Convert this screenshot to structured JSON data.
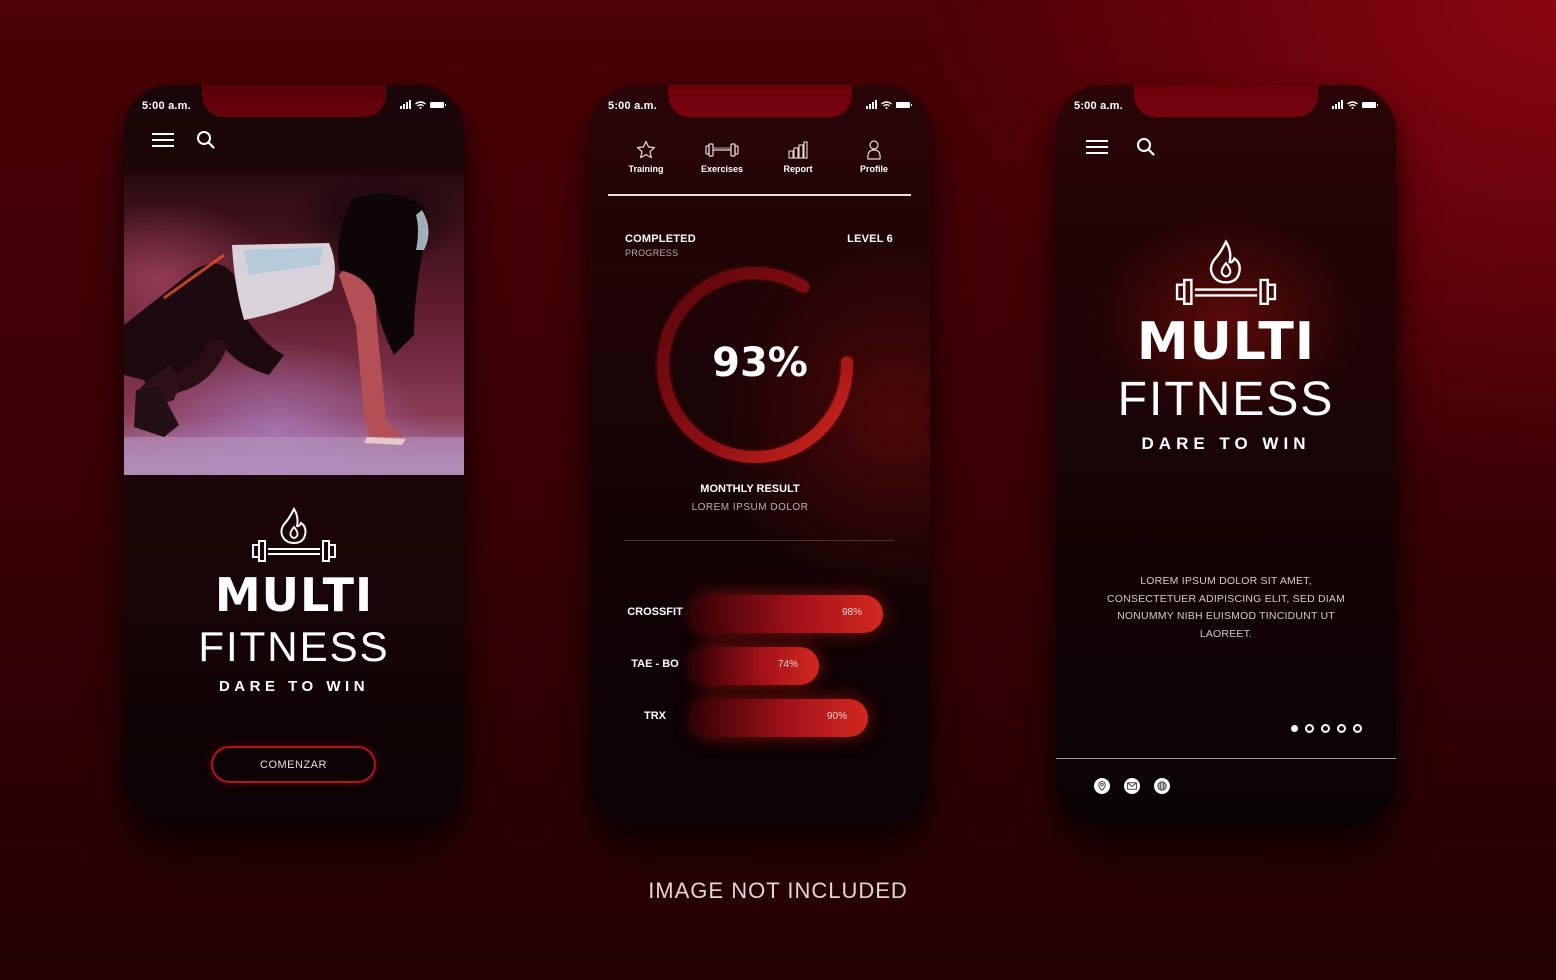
{
  "status_bar": {
    "time": "5:00 a.m."
  },
  "brand": {
    "name_primary": "MULTI",
    "name_secondary": "FITNESS",
    "tagline": "DARE TO WIN",
    "icon": "flame-barbell-icon"
  },
  "colors": {
    "accent": "#c81e1e",
    "accent_dark": "#7a0008",
    "background": "#3a0005",
    "phone_bg": "#120406",
    "text": "#ffffff",
    "text_muted": "#bdb0b0"
  },
  "screen_welcome": {
    "menu_icon": "hamburger-menu-icon",
    "search_icon": "search-icon",
    "hero_image_alt": "Woman in sprint start position with pink smoke",
    "cta_label": "COMENZAR"
  },
  "screen_progress": {
    "tabs": [
      {
        "label": "Training",
        "icon": "star-icon"
      },
      {
        "label": "Exercises",
        "icon": "dumbbell-icon"
      },
      {
        "label": "Report",
        "icon": "bar-chart-icon"
      },
      {
        "label": "Profile",
        "icon": "user-icon"
      }
    ],
    "completed_title": "COMPLETED",
    "completed_sub": "PROGRESS",
    "level_label": "LEVEL 6",
    "ring_percent": 93,
    "ring_label": "93%",
    "monthly_title": "MONTHLY RESULT",
    "monthly_sub": "LOREM IPSUM DOLOR",
    "bars": [
      {
        "label": "CROSSFIT",
        "percent": 98,
        "value_label": "98%"
      },
      {
        "label": "TAE - BO",
        "percent": 74,
        "value_label": "74%"
      },
      {
        "label": "TRX",
        "percent": 90,
        "value_label": "90%"
      }
    ]
  },
  "screen_splash": {
    "description": "LOREM IPSUM DOLOR SIT AMET, CONSECTETUER ADIPISCING ELIT, SED DIAM NONUMMY NIBH EUISMOD TINCIDUNT UT LAOREET.",
    "pagination": {
      "total": 5,
      "active_index": 0
    },
    "social_links": [
      {
        "icon": "location-pin-icon"
      },
      {
        "icon": "mail-icon"
      },
      {
        "icon": "globe-icon"
      }
    ]
  },
  "caption": "IMAGE NOT INCLUDED"
}
